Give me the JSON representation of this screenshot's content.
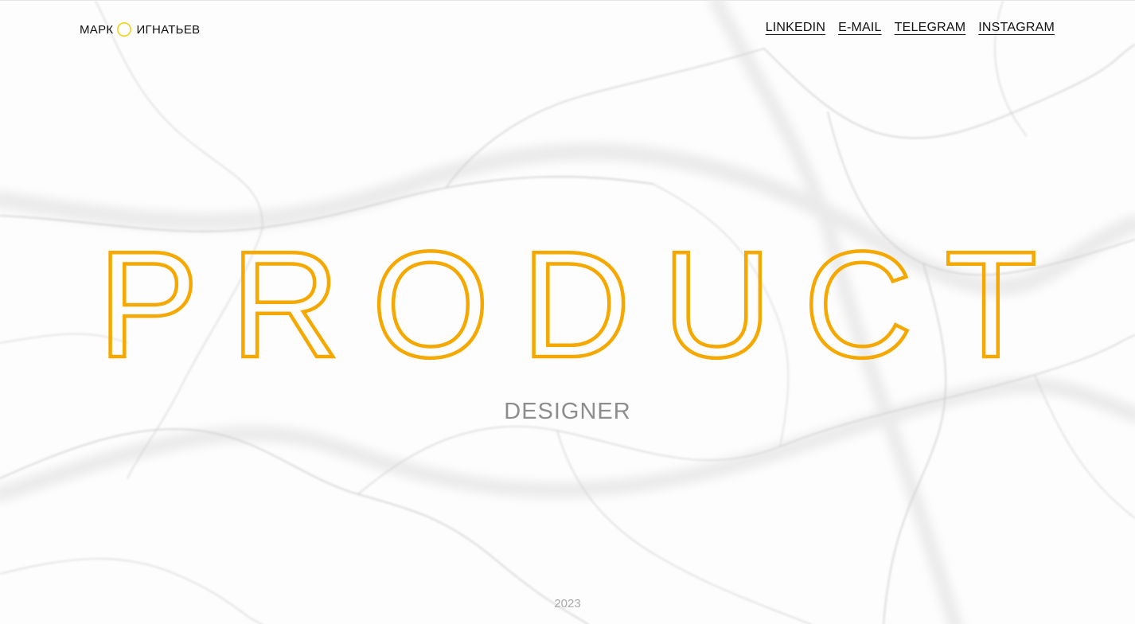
{
  "brand": {
    "first_name": "МАРК",
    "last_name": "ИГНАТЬЕВ",
    "icon": "yellow-ring-icon"
  },
  "nav": {
    "items": [
      {
        "label": "LINKEDIN"
      },
      {
        "label": "E-MAIL"
      },
      {
        "label": "TELEGRAM"
      },
      {
        "label": "INSTAGRAM"
      }
    ]
  },
  "hero": {
    "title": "PRODUCT",
    "subtitle": "DESIGNER"
  },
  "footer": {
    "year": "2023"
  },
  "colors": {
    "accent": "#F5A800",
    "ring": "#F2D21B",
    "text": "#111111",
    "muted": "#8D8D8D"
  }
}
